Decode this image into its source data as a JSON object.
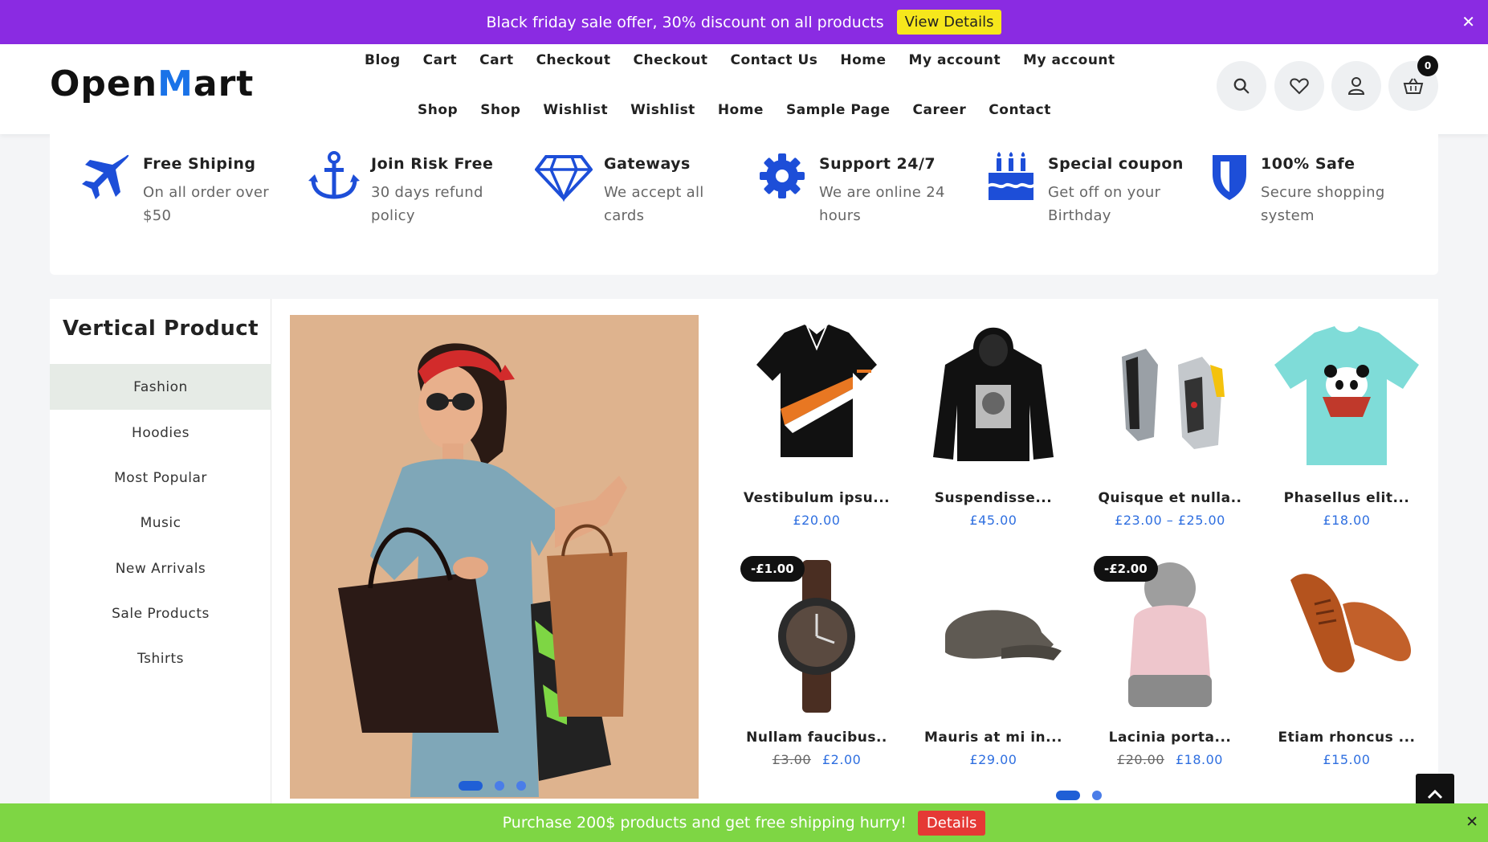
{
  "promo_top": {
    "text": "Black friday sale offer, 30% discount on all products",
    "button": "View Details",
    "close": "✕"
  },
  "header": {
    "logo_open": "Open",
    "logo_m": "M",
    "logo_art": "art",
    "nav_row1": [
      "Blog",
      "Cart",
      "Cart",
      "Checkout",
      "Checkout",
      "Contact Us",
      "Home",
      "My account",
      "My account"
    ],
    "nav_row2": [
      "Shop",
      "Shop",
      "Wishlist",
      "Wishlist",
      "Home",
      "Sample Page",
      "Career",
      "Contact"
    ],
    "cart_count": "0"
  },
  "features": [
    {
      "title": "Free Shiping",
      "desc": "On all order over $50",
      "icon": "airplane-icon"
    },
    {
      "title": "Join Risk Free",
      "desc": "30 days refund policy",
      "icon": "anchor-icon"
    },
    {
      "title": "Gateways",
      "desc": "We accept all cards",
      "icon": "diamond-icon"
    },
    {
      "title": "Support 24/7",
      "desc": "We are online 24 hours",
      "icon": "gear-icon"
    },
    {
      "title": "Special coupon",
      "desc": "Get off on your Birthday",
      "icon": "cake-icon"
    },
    {
      "title": "100% Safe",
      "desc": "Secure shopping system",
      "icon": "shield-icon"
    }
  ],
  "sidebar": {
    "title": "Vertical Product",
    "items": [
      "Fashion",
      "Hoodies",
      "Most Popular",
      "Music",
      "New Arrivals",
      "Sale Products",
      "Tshirts"
    ],
    "active_index": 0
  },
  "products": [
    {
      "name": "Vestibulum ipsu...",
      "price": "£20.00",
      "old": "",
      "sale": ""
    },
    {
      "name": "Suspendisse...",
      "price": "£45.00",
      "old": "",
      "sale": ""
    },
    {
      "name": "Quisque et nulla..",
      "price": "£23.00 – £25.00",
      "old": "",
      "sale": ""
    },
    {
      "name": "Phasellus elit...",
      "price": "£18.00",
      "old": "",
      "sale": ""
    },
    {
      "name": "Nullam faucibus..",
      "price": "£2.00",
      "old": "£3.00",
      "sale": "-£1.00"
    },
    {
      "name": "Mauris at mi in...",
      "price": "£29.00",
      "old": "",
      "sale": ""
    },
    {
      "name": "Lacinia porta...",
      "price": "£18.00",
      "old": "£20.00",
      "sale": "-£2.00"
    },
    {
      "name": "Etiam rhoncus ...",
      "price": "£15.00",
      "old": "",
      "sale": ""
    }
  ],
  "promo_bottom": {
    "text": "Purchase 200$ products and get free shipping hurry!",
    "button": "Details",
    "close": "✕"
  },
  "colors": {
    "accent": "#8a2be2",
    "brand_blue": "#1a73e8",
    "green_bar": "#7ed644",
    "price_blue": "#2f6fe0"
  }
}
